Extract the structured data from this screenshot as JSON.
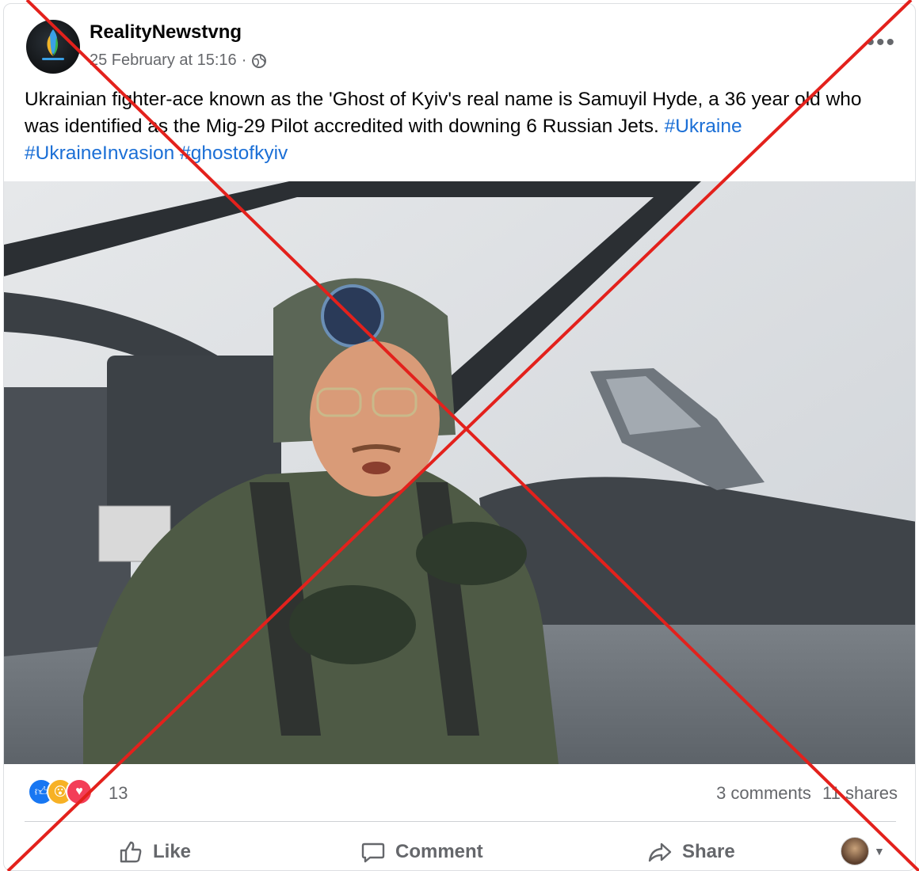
{
  "post": {
    "author": "RealityNewstvng",
    "timestamp": "25 February at 15:16",
    "separator": "·",
    "more_label": "•••",
    "text_part1": "Ukrainian fighter-ace known as the 'Ghost of Kyiv's real name is Samuyil Hyde, a 36 year old who was identified as the Mig-29 Pilot accredited with downing 6 Russian Jets.",
    "hashtags": [
      "#Ukraine",
      "#UkraineInvasion",
      "#ghostofkyiv"
    ]
  },
  "stats": {
    "reaction_count": "13",
    "comments": "3 comments",
    "shares": "11 shares",
    "reactions": [
      "like-icon",
      "wow-icon",
      "care-icon"
    ]
  },
  "actions": {
    "like": "Like",
    "comment": "Comment",
    "share": "Share"
  },
  "colors": {
    "hashtag": "#1b6fd6",
    "overlay_cross": "#e3211c",
    "like_blue": "#1877f2"
  }
}
